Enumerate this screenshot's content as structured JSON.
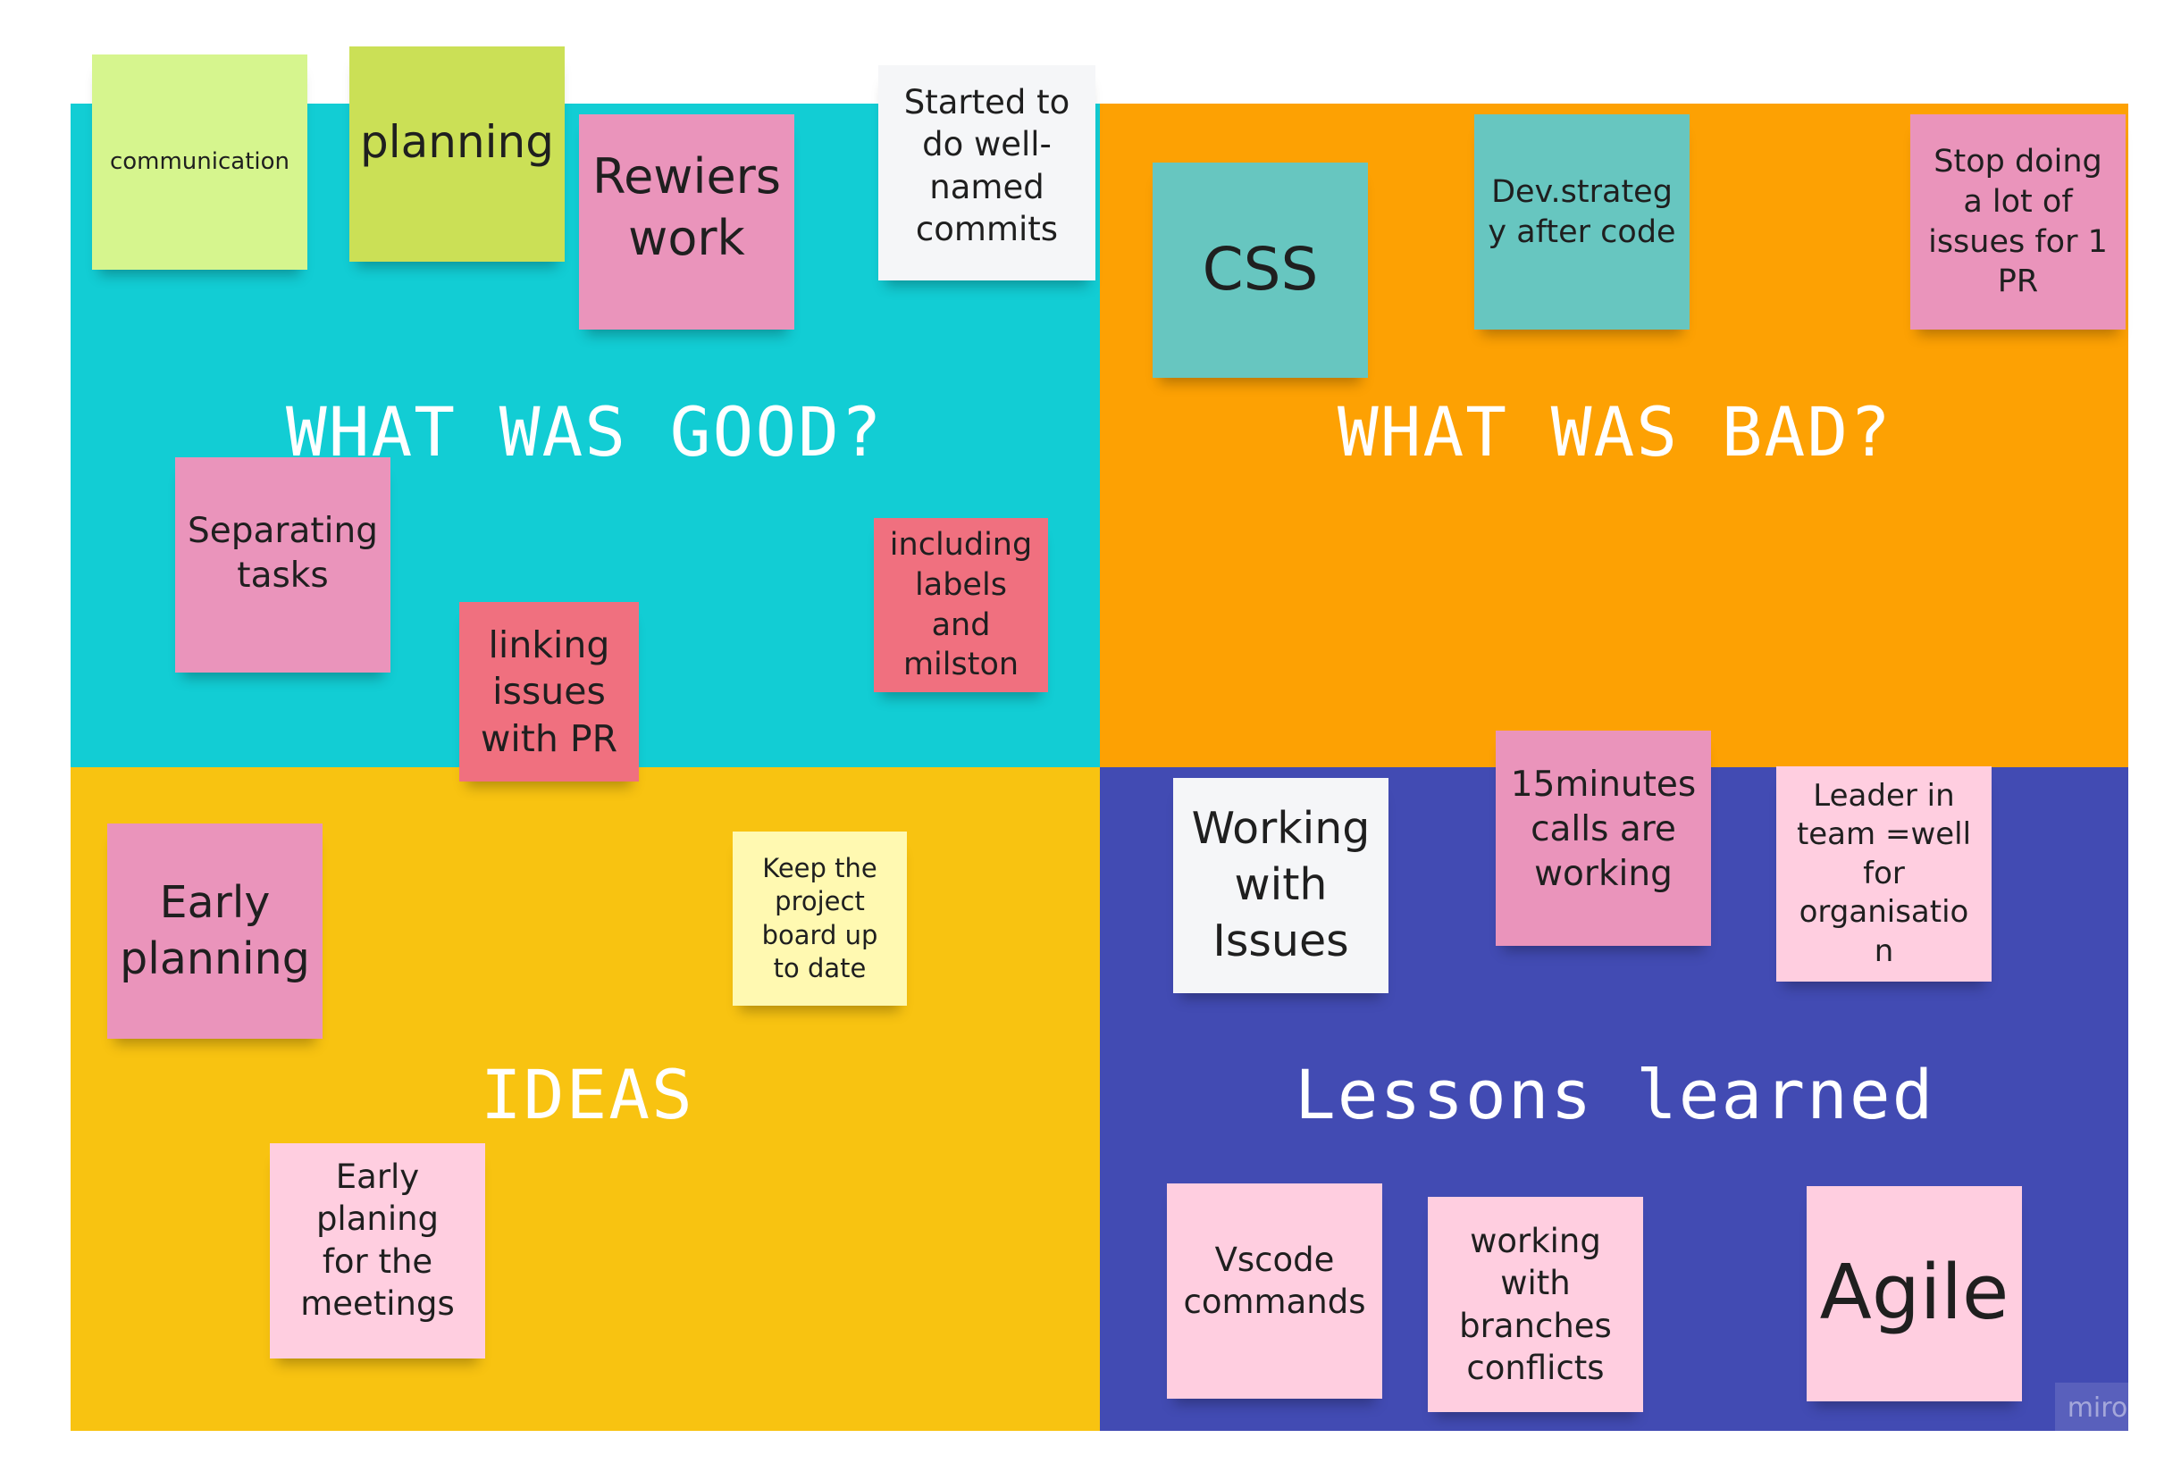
{
  "quadrants": {
    "good": {
      "title": "WHAT WAS GOOD?",
      "color": "#12cdd4"
    },
    "bad": {
      "title": "WHAT WAS BAD?",
      "color": "#fda103"
    },
    "ideas": {
      "title": "IDEAS",
      "color": "#f8c311"
    },
    "lessons": {
      "title": "Lessons learned",
      "color": "#424bb3"
    }
  },
  "notes": {
    "communication": "communication",
    "planning": "planning",
    "rewiers_work": "Rewiers work",
    "well_named_commits": "Started to do well-named commits",
    "separating_tasks": "Separating tasks",
    "linking_issues": "linking issues with PR",
    "labels_milston": "including labels and milston",
    "css": "CSS",
    "dev_strategy": "Dev.strategy after code",
    "stop_doing": "Stop doing a lot of issues for 1 PR",
    "early_planning": "Early planning",
    "keep_board": "Keep the project board up to date",
    "early_planing_meetings": "Early planing for the meetings",
    "working_with_issues": "Working with Issues",
    "calls_15min": "15minutes calls are working",
    "leader_in_team": "Leader in team =well for organisation",
    "vscode_commands": "Vscode commands",
    "branches_conflicts": "working with branches conflicts",
    "agile": "Agile"
  },
  "note_colors": {
    "light_green": "#d6f58e",
    "lime": "#cbe056",
    "pink": "#ea94bb",
    "white": "#f5f6f8",
    "red": "#f0707f",
    "teal": "#67c6c0",
    "light_yellow": "#fff9b1",
    "light_pink": "#ffcee0"
  },
  "watermark": "miro"
}
